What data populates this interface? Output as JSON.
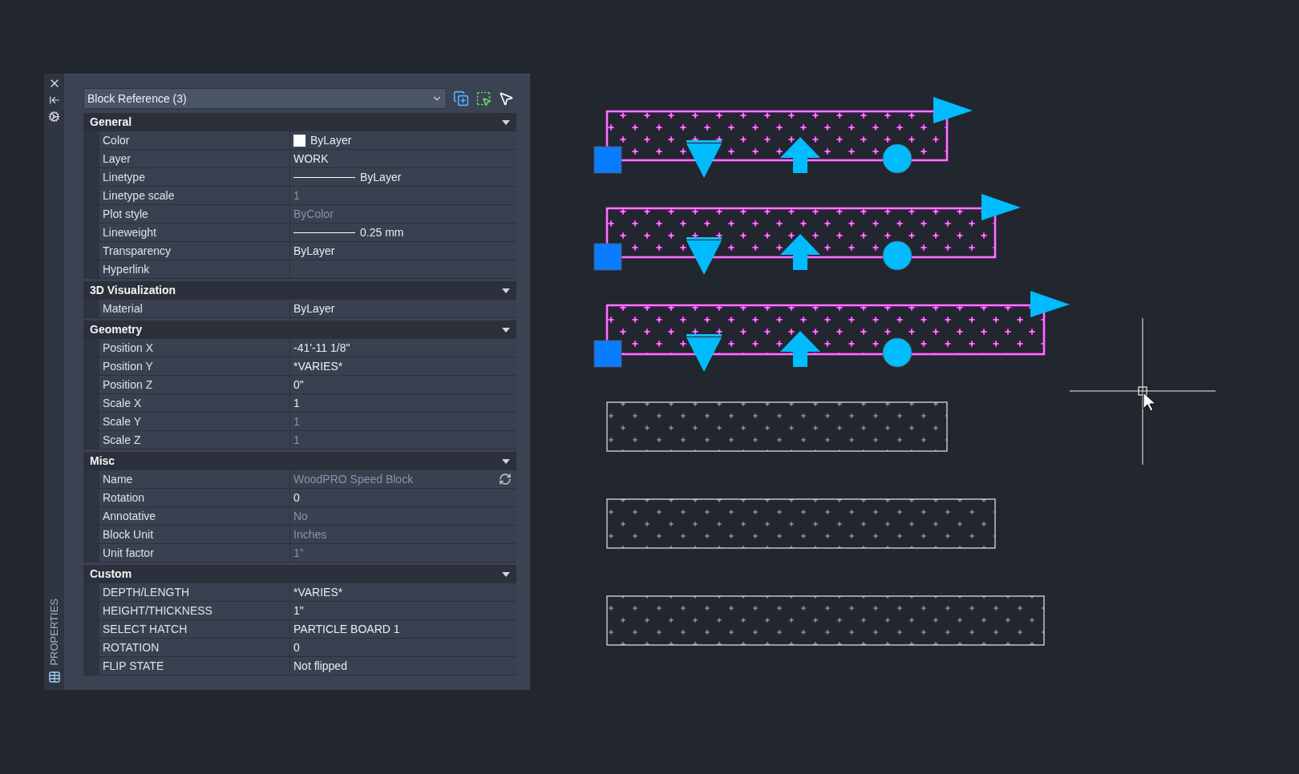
{
  "palette": {
    "title": "PROPERTIES",
    "selection": "Block Reference (3)",
    "sections": [
      {
        "title": "General",
        "expanded": true,
        "rows": [
          {
            "label": "Color",
            "value": "ByLayer",
            "kind": "color",
            "dimmed": false
          },
          {
            "label": "Layer",
            "value": "WORK",
            "kind": "text",
            "dimmed": false
          },
          {
            "label": "Linetype",
            "value": "ByLayer",
            "kind": "line",
            "dimmed": false
          },
          {
            "label": "Linetype scale",
            "value": "1",
            "kind": "text",
            "dimmed": true
          },
          {
            "label": "Plot style",
            "value": "ByColor",
            "kind": "text",
            "dimmed": true
          },
          {
            "label": "Lineweight",
            "value": "0.25 mm",
            "kind": "line",
            "dimmed": false
          },
          {
            "label": "Transparency",
            "value": "ByLayer",
            "kind": "text",
            "dimmed": false
          },
          {
            "label": "Hyperlink",
            "kind": "text",
            "dimmed": false
          }
        ]
      },
      {
        "title": "3D Visualization",
        "expanded": true,
        "rows": [
          {
            "label": "Material",
            "value": "ByLayer",
            "kind": "text",
            "dimmed": false
          }
        ]
      },
      {
        "title": "Geometry",
        "expanded": true,
        "rows": [
          {
            "label": "Position X",
            "value": "-41'-11 1/8\"",
            "kind": "text",
            "dimmed": false
          },
          {
            "label": "Position Y",
            "value": "*VARIES*",
            "kind": "text",
            "dimmed": false
          },
          {
            "label": "Position Z",
            "value": "0\"",
            "kind": "text",
            "dimmed": false
          },
          {
            "label": "Scale X",
            "value": "1",
            "kind": "text",
            "dimmed": false
          },
          {
            "label": "Scale Y",
            "value": "1",
            "kind": "text",
            "dimmed": true
          },
          {
            "label": "Scale Z",
            "value": "1",
            "kind": "text",
            "dimmed": true
          }
        ]
      },
      {
        "title": "Misc",
        "expanded": true,
        "rows": [
          {
            "label": "Name",
            "value": "WoodPRO Speed Block",
            "kind": "editor",
            "dimmed": true
          },
          {
            "label": "Rotation",
            "value": "0",
            "kind": "text",
            "dimmed": false
          },
          {
            "label": "Annotative",
            "value": "No",
            "kind": "text",
            "dimmed": true
          },
          {
            "label": "Block Unit",
            "value": "Inches",
            "kind": "text",
            "dimmed": true
          },
          {
            "label": "Unit factor",
            "value": "1\"",
            "kind": "text",
            "dimmed": true
          }
        ]
      },
      {
        "title": "Custom",
        "expanded": true,
        "rows": [
          {
            "label": "DEPTH/LENGTH",
            "value": "*VARIES*",
            "kind": "text",
            "dimmed": false
          },
          {
            "label": "HEIGHT/THICKNESS",
            "value": "1\"",
            "kind": "text",
            "dimmed": false
          },
          {
            "label": "SELECT HATCH",
            "value": "PARTICLE BOARD 1",
            "kind": "text",
            "dimmed": false
          },
          {
            "label": "ROTATION",
            "value": "0",
            "kind": "text",
            "dimmed": false
          },
          {
            "label": "FLIP STATE",
            "value": "Not flipped",
            "kind": "text",
            "dimmed": false
          }
        ]
      }
    ]
  },
  "drawing": {
    "blocks": [
      {
        "selected": true
      },
      {
        "selected": true
      },
      {
        "selected": true
      },
      {
        "selected": false
      },
      {
        "selected": false
      },
      {
        "selected": false
      }
    ]
  }
}
